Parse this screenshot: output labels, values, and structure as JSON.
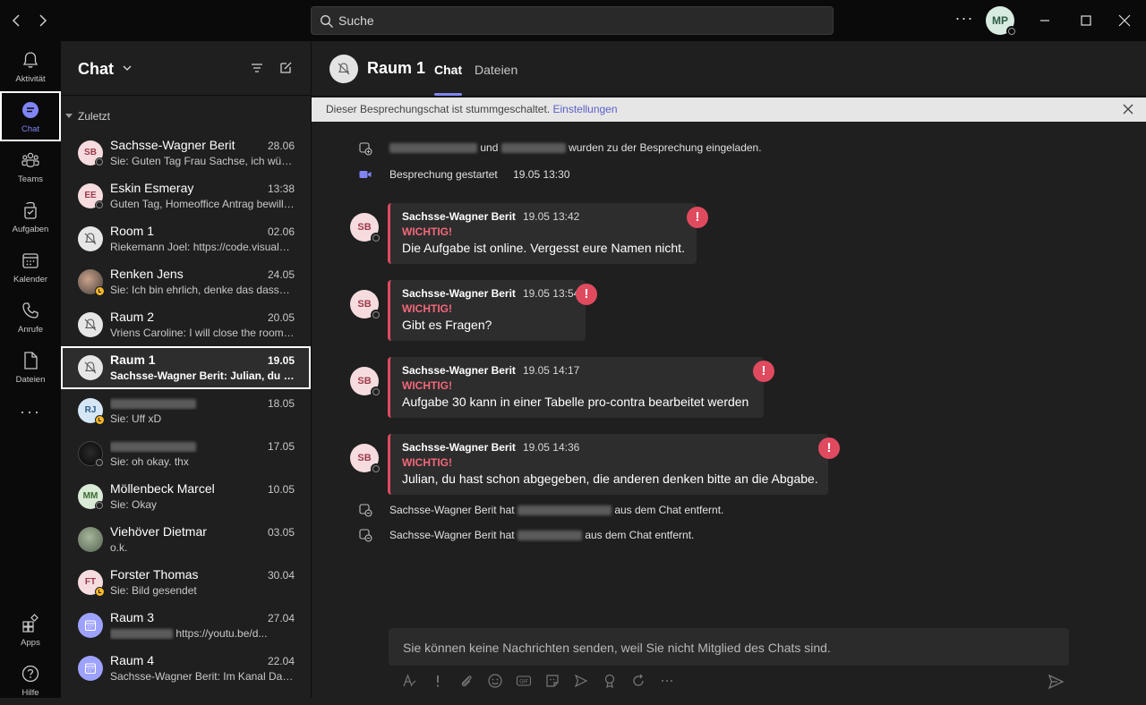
{
  "titlebar": {
    "back_icon": "chevron-left-icon",
    "forward_icon": "chevron-right-icon",
    "search_placeholder": "Suche",
    "more_label": "···",
    "user_initials": "MP"
  },
  "rail": {
    "items": [
      {
        "label": "Aktivität",
        "icon": "bell-icon"
      },
      {
        "label": "Chat",
        "icon": "chat-icon",
        "active": true
      },
      {
        "label": "Teams",
        "icon": "teams-icon"
      },
      {
        "label": "Aufgaben",
        "icon": "tasks-icon"
      },
      {
        "label": "Kalender",
        "icon": "calendar-icon"
      },
      {
        "label": "Anrufe",
        "icon": "phone-icon"
      },
      {
        "label": "Dateien",
        "icon": "file-icon"
      }
    ],
    "more": "···",
    "bottom": [
      {
        "label": "Apps",
        "icon": "apps-icon"
      },
      {
        "label": "Hilfe",
        "icon": "help-icon"
      }
    ]
  },
  "chatlist": {
    "title": "Chat",
    "section": "Zuletzt",
    "items": [
      {
        "name": "Sachsse-Wagner Berit",
        "initials": "SB",
        "date": "28.06",
        "preview": "Sie: Guten Tag Frau Sachse, ich würde..."
      },
      {
        "name": "Eskin Esmeray",
        "initials": "EE",
        "date": "13:38",
        "preview": "Guten Tag, Homeoffice Antrag bewilligt"
      },
      {
        "name": "Room 1",
        "date": "02.06",
        "preview": "Riekemann Joel: https://code.visualstudio.com"
      },
      {
        "name": "Renken Jens",
        "date": "24.05",
        "preview": "Sie: Ich bin ehrlich, denke das dasselbe"
      },
      {
        "name": "Raum 2",
        "date": "20.05",
        "preview": "Vriens Caroline: I will close the room now"
      },
      {
        "name": "Raum 1",
        "date": "19.05",
        "preview": "Sachsse-Wagner Berit: Julian, du hast schon abgegeben"
      },
      {
        "name": "",
        "initials": "RJ",
        "date": "18.05",
        "preview": "Sie: Uff xD"
      },
      {
        "name": "",
        "date": "17.05",
        "preview": "Sie: oh okay. thx"
      },
      {
        "name": "Möllenbeck Marcel",
        "initials": "MM",
        "date": "10.05",
        "preview": "Sie: Okay"
      },
      {
        "name": "Viehöver Dietmar",
        "date": "03.05",
        "preview": "o.k."
      },
      {
        "name": "Forster Thomas",
        "initials": "FT",
        "date": "30.04",
        "preview": "Sie: Bild gesendet"
      },
      {
        "name": "Raum 3",
        "date": "27.04",
        "preview": "https://youtu.be/d..."
      },
      {
        "name": "Raum 4",
        "date": "22.04",
        "preview": "Sachsse-Wagner Berit: Im Kanal Dateien"
      }
    ]
  },
  "main": {
    "title": "Raum 1",
    "tabs": [
      {
        "label": "Chat"
      },
      {
        "label": "Dateien"
      }
    ],
    "banner_text": "Dieser Besprechungschat ist stummgeschaltet.",
    "banner_link": "Einstellungen",
    "sys_invited_and": "und",
    "sys_invited_suffix": "wurden zu der Besprechung eingeladen.",
    "meeting_started": "Besprechung gestartet",
    "meeting_started_time": "19.05 13:30",
    "messages": [
      {
        "author": "Sachsse-Wagner Berit",
        "time": "19.05 13:42",
        "flag": "WICHTIG!",
        "text": "Die Aufgabe ist online. Vergesst eure Namen nicht."
      },
      {
        "author": "Sachsse-Wagner Berit",
        "time": "19.05 13:54",
        "flag": "WICHTIG!",
        "text": "Gibt es Fragen?"
      },
      {
        "author": "Sachsse-Wagner Berit",
        "time": "19.05 14:17",
        "flag": "WICHTIG!",
        "text": "Aufgabe 30 kann in einer Tabelle pro-contra bearbeitet werden"
      },
      {
        "author": "Sachsse-Wagner Berit",
        "time": "19.05 14:36",
        "flag": "WICHTIG!",
        "text": "Julian, du hast schon abgegeben, die anderen denken bitte an die Abgabe."
      }
    ],
    "msg_initials": "SB",
    "removed": [
      {
        "actor": "Sachsse-Wagner Berit hat",
        "suffix": "aus dem Chat entfernt."
      },
      {
        "actor": "Sachsse-Wagner Berit hat",
        "suffix": "aus dem Chat entfernt."
      }
    ],
    "compose_text": "Sie können keine Nachrichten senden, weil Sie nicht Mitglied des Chats sind."
  },
  "colors": {
    "accent": "#7f85f5",
    "important": "#e04a5f",
    "background": "#1f1f1f"
  }
}
